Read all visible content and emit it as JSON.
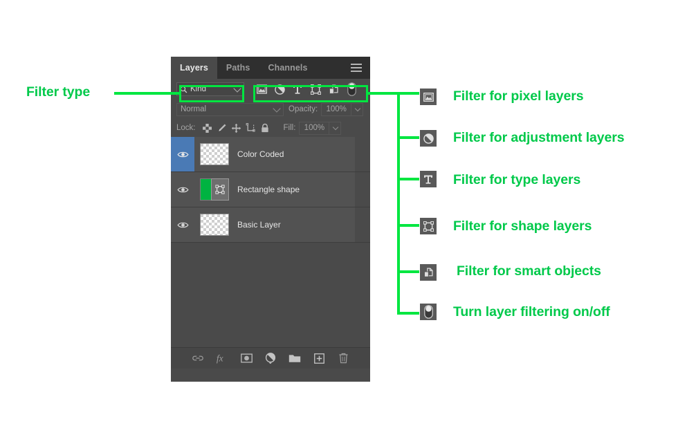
{
  "app": {
    "name": "Photoshop Layers Panel"
  },
  "panel": {
    "tabs": [
      {
        "label": "Layers",
        "active": true,
        "name": "tab-layers"
      },
      {
        "label": "Paths",
        "active": false,
        "name": "tab-paths"
      },
      {
        "label": "Channels",
        "active": false,
        "name": "tab-channels"
      }
    ],
    "menu_icon": "hamburger-menu-icon",
    "filter": {
      "search_icon": "magnifier-icon",
      "kind_label": "Kind",
      "caret_icon": "chevron-down-icon",
      "icons": [
        {
          "name": "filter-pixel-layers-icon",
          "glyph": "image-icon"
        },
        {
          "name": "filter-adjustment-layers-icon",
          "glyph": "half-circle-icon"
        },
        {
          "name": "filter-type-layers-icon",
          "glyph": "letter-t-icon"
        },
        {
          "name": "filter-shape-layers-icon",
          "glyph": "shape-node-icon"
        },
        {
          "name": "filter-smart-objects-icon",
          "glyph": "smart-object-icon"
        },
        {
          "name": "layer-filter-toggle",
          "glyph": "toggle-switch-icon"
        }
      ]
    },
    "blend": {
      "mode": "Normal",
      "opacity_label": "Opacity:",
      "opacity_value": "100%"
    },
    "lock": {
      "label": "Lock:",
      "icons": [
        {
          "name": "lock-transparent-pixels-icon",
          "glyph": "checkerboard-icon"
        },
        {
          "name": "lock-image-pixels-icon",
          "glyph": "brush-icon"
        },
        {
          "name": "lock-position-icon",
          "glyph": "move-arrows-icon"
        },
        {
          "name": "lock-artboard-nesting-icon",
          "glyph": "artboard-icon"
        },
        {
          "name": "lock-all-icon",
          "glyph": "padlock-icon"
        }
      ],
      "fill_label": "Fill:",
      "fill_value": "100%"
    },
    "layers": [
      {
        "name": "Color Coded",
        "visible": true,
        "selected": true,
        "thumb": "transparent",
        "has_vector_mask": false
      },
      {
        "name": "Rectangle shape",
        "visible": true,
        "selected": false,
        "thumb": "green",
        "has_vector_mask": true
      },
      {
        "name": "Basic Layer",
        "visible": true,
        "selected": false,
        "thumb": "transparent",
        "has_vector_mask": false
      }
    ],
    "bottom_buttons": [
      {
        "name": "link-layers-button",
        "glyph": "link-icon"
      },
      {
        "name": "layer-style-button",
        "glyph": "fx-icon"
      },
      {
        "name": "add-layer-mask-button",
        "glyph": "mask-icon"
      },
      {
        "name": "new-adjustment-layer-button",
        "glyph": "half-circle-icon"
      },
      {
        "name": "new-group-button",
        "glyph": "folder-icon"
      },
      {
        "name": "new-layer-button",
        "glyph": "plus-square-icon"
      },
      {
        "name": "delete-layer-button",
        "glyph": "trash-icon"
      }
    ]
  },
  "annotations": {
    "accent_color": "#00e640",
    "text_color": "#00c94a",
    "left": {
      "label": "Filter type"
    },
    "right": [
      {
        "label": "Filter for pixel layers",
        "icon": "image-icon"
      },
      {
        "label": "Filter for adjustment layers",
        "icon": "half-circle-icon"
      },
      {
        "label": "Filter for type layers",
        "icon": "letter-t-icon"
      },
      {
        "label": "Filter for shape layers",
        "icon": "shape-node-icon"
      },
      {
        "label": "Filter for smart objects",
        "icon": "smart-object-icon"
      },
      {
        "label": "Turn layer filtering on/off",
        "icon": "toggle-switch-icon"
      }
    ]
  }
}
